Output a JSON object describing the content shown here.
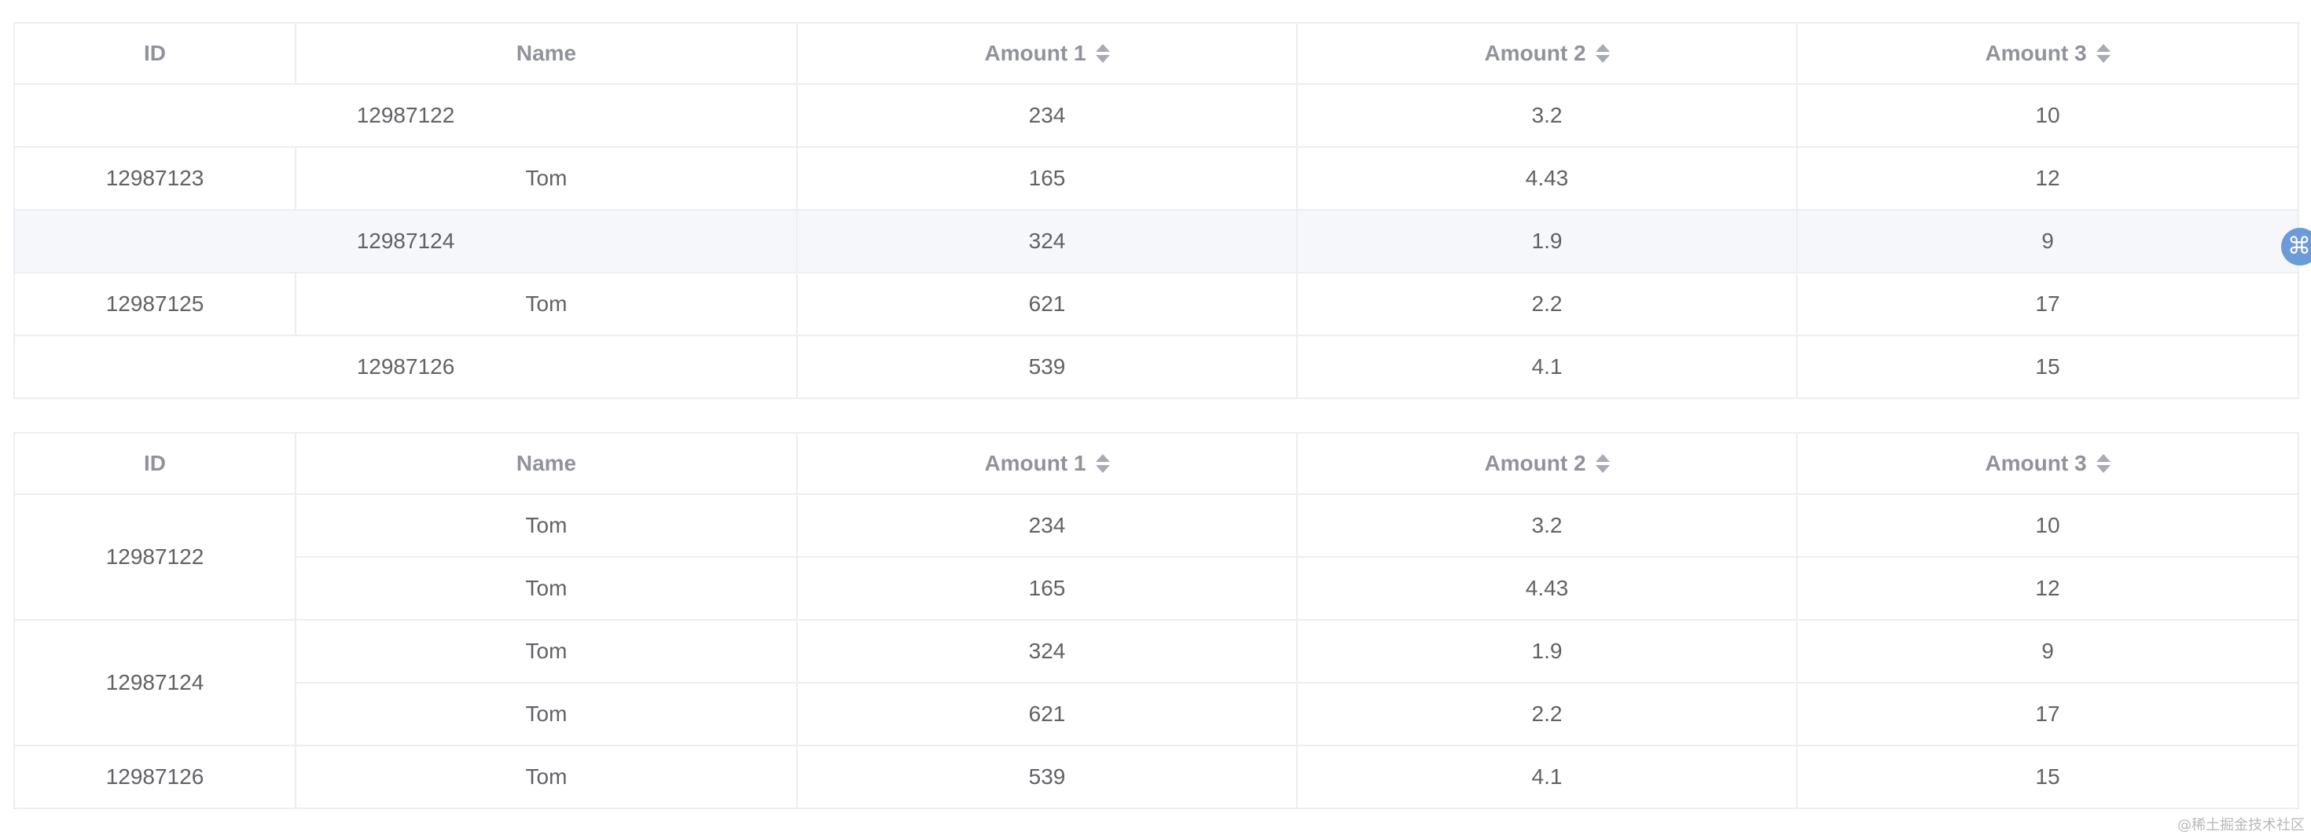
{
  "table1": {
    "headers": [
      "ID",
      "Name",
      "Amount 1",
      "Amount 2",
      "Amount 3"
    ],
    "rows": [
      {
        "id": "",
        "name": "12987122",
        "amount1": "234",
        "amount2": "3.2",
        "amount3": "10"
      },
      {
        "id": "12987123",
        "name": "Tom",
        "amount1": "165",
        "amount2": "4.43",
        "amount3": "12"
      },
      {
        "id": "",
        "name": "12987124",
        "amount1": "324",
        "amount2": "1.9",
        "amount3": "9"
      },
      {
        "id": "12987125",
        "name": "Tom",
        "amount1": "621",
        "amount2": "2.2",
        "amount3": "17"
      },
      {
        "id": "",
        "name": "12987126",
        "amount1": "539",
        "amount2": "4.1",
        "amount3": "15"
      }
    ]
  },
  "table2": {
    "headers": [
      "ID",
      "Name",
      "Amount 1",
      "Amount 2",
      "Amount 3"
    ],
    "id_groups": [
      "12987122",
      "12987124",
      "12987126"
    ],
    "rows": [
      {
        "name": "Tom",
        "amount1": "234",
        "amount2": "3.2",
        "amount3": "10"
      },
      {
        "name": "Tom",
        "amount1": "165",
        "amount2": "4.43",
        "amount3": "12"
      },
      {
        "name": "Tom",
        "amount1": "324",
        "amount2": "1.9",
        "amount3": "9"
      },
      {
        "name": "Tom",
        "amount1": "621",
        "amount2": "2.2",
        "amount3": "17"
      },
      {
        "name": "Tom",
        "amount1": "539",
        "amount2": "4.1",
        "amount3": "15"
      }
    ]
  },
  "float_button": {
    "glyph": "⌘"
  },
  "watermark": "@稀土掘金技术社区",
  "icons": {
    "sort": "sort-caret-icon",
    "float": "command-icon"
  },
  "colors": {
    "border": "#ebeef5",
    "header_text": "#909399",
    "cell_text": "#606266",
    "hover_row": "#f5f7fa",
    "float_button": "#6b9bd8"
  }
}
